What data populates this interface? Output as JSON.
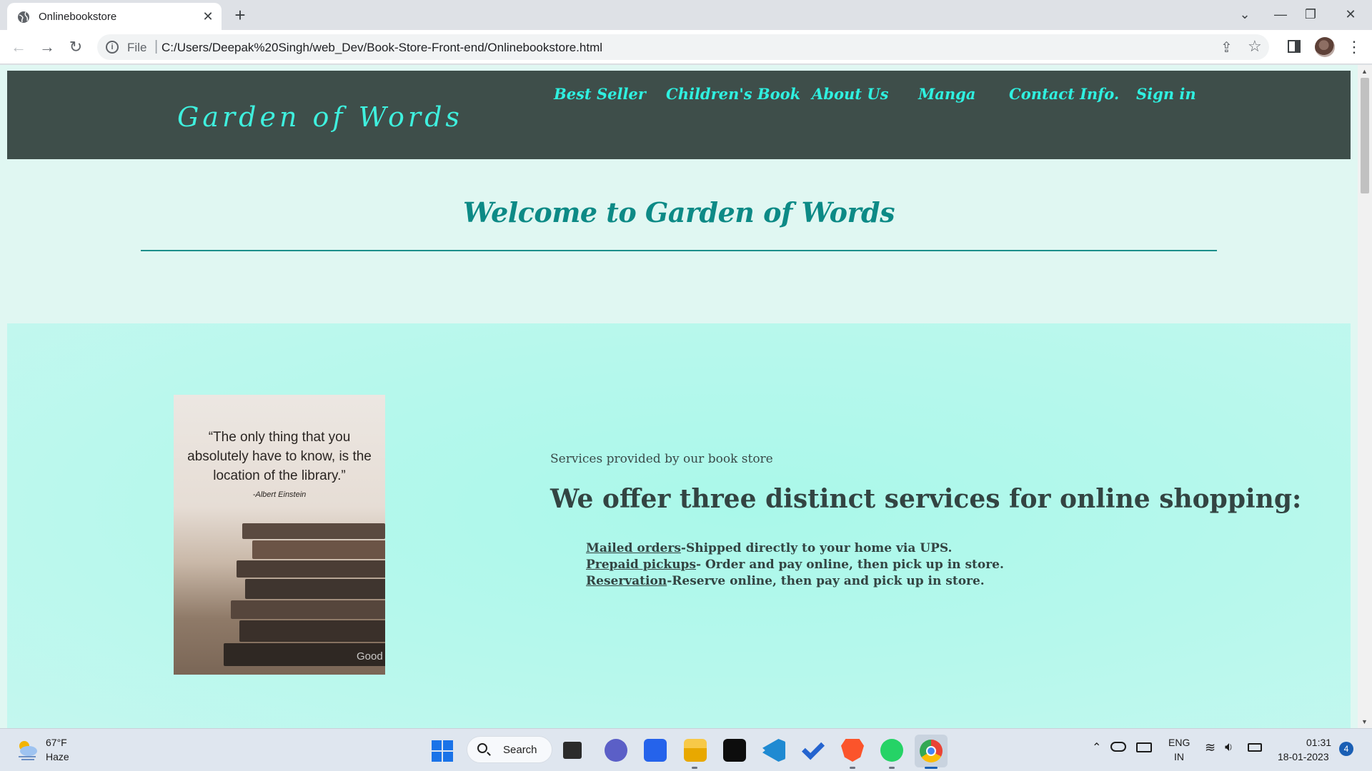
{
  "browser": {
    "tab_title": "Onlinebookstore",
    "tab_close": "✕",
    "new_tab": "+",
    "scheme_label": "File",
    "url": "C:/Users/Deepak%20Singh/web_Dev/Book-Store-Front-end/Onlinebookstore.html",
    "window_controls": {
      "dropdown": "⌄",
      "minimize": "—",
      "restore": "❐",
      "close": "✕"
    }
  },
  "site": {
    "logo": "Garden of Words",
    "nav": [
      "Best Seller",
      "Children's Book",
      "About Us",
      "Manga",
      "Contact Info.",
      "Sign in"
    ],
    "welcome": "Welcome to Garden of Words",
    "image": {
      "quote": "“The only thing that you absolutely have to know, is the location of the library.”",
      "author": "-Albert Einstein",
      "watermark": "Good"
    },
    "services": {
      "intro": "Services provided by our book store",
      "heading": "We offer three distinct services for online shopping:",
      "items": [
        {
          "link": "Mailed orders",
          "text": "-Shipped directly to your home via UPS."
        },
        {
          "link": "Prepaid pickups",
          "text": "- Order and pay online, then pick up in store."
        },
        {
          "link": "Reservation",
          "text": "-Reserve online, then pay and pick up in store."
        }
      ]
    }
  },
  "taskbar": {
    "weather_temp": "67°F",
    "weather_condition": "Haze",
    "search_label": "Search",
    "language_line1": "ENG",
    "language_line2": "IN",
    "time": "01:31",
    "date": "18-01-2023",
    "notification_count": "4"
  },
  "colors": {
    "header_bg": "#3e4e4a",
    "accent_cyan": "#2ff0e0",
    "welcome_teal": "#0d8a86",
    "services_bg": "#b6f8ec"
  }
}
